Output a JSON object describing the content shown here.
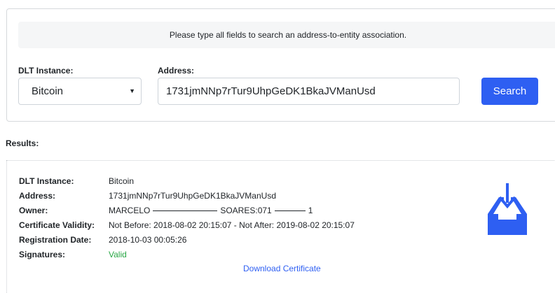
{
  "search": {
    "hint": "Please type all fields to search an address-to-entity association.",
    "dlt_label": "DLT Instance:",
    "dlt_value": "Bitcoin",
    "address_label": "Address:",
    "address_value": "1731jmNNp7rTur9UhpGeDK1BkaJVManUsd",
    "search_label": "Search"
  },
  "results": {
    "label": "Results:",
    "dlt_key": "DLT Instance:",
    "dlt_val": "Bitcoin",
    "address_key": "Address:",
    "address_val": "1731jmNNp7rTur9UhpGeDK1BkaJVManUsd",
    "owner_key": "Owner:",
    "owner_part1": "MARCELO",
    "owner_part2": "SOARES:071",
    "owner_part3": "1",
    "validity_key": "Certificate Validity:",
    "validity_val": "Not Before: 2018-08-02 20:15:07 - Not After: 2019-08-02 20:15:07",
    "registration_key": "Registration Date:",
    "registration_val": "2018-10-03 00:05:26",
    "signatures_key": "Signatures:",
    "signatures_val": "Valid",
    "download_label": "Download Certificate",
    "icon": "inbox-download-icon"
  },
  "colors": {
    "accent": "#2e5ff2",
    "valid": "#28a745"
  }
}
